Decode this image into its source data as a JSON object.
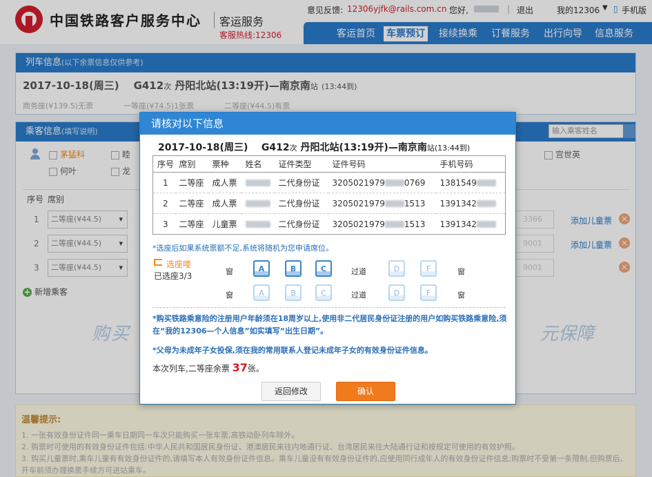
{
  "header": {
    "brand_title": "中国铁路客户服务中心",
    "brand_sub": "客运服务",
    "hotline": "客服热线:12306",
    "feedback_label": "意见反馈:",
    "feedback_email": "12306yjfk@rails.com.cn",
    "hello": "您好,",
    "logout": "退出",
    "my12306": "我的12306",
    "mobile": "手机版",
    "nav": [
      "客运首页",
      "车票预订",
      "接续换乘",
      "订餐服务",
      "出行向导",
      "信息服务"
    ],
    "nav_active": "车票预订"
  },
  "train_panel": {
    "title": "列车信息",
    "subtitle": "(以下余票信息仅供参考)",
    "date": "2017-10-18(周三)",
    "train_no": "G412",
    "ci": "次",
    "from": "丹阳北",
    "from_suffix": "站(13:19开)—",
    "to": "南京南",
    "to_suffix": "站",
    "arrive": "(13:44到)",
    "seats": "商务座(¥139.5)无票　　　　一等座(¥74.5)1张票　　　　二等座(¥44.5)有票"
  },
  "passenger_panel": {
    "title": "乘客信息",
    "subtitle": "(填写说明)",
    "search_placeholder": "输入乘客姓名",
    "passengers_visible": [
      "茅猛科",
      "何叶",
      "宫世英"
    ],
    "partial_1": "睦",
    "partial_2": "龙",
    "col_no": "序号",
    "col_seat": "席别",
    "rows": [
      {
        "no": "1",
        "seat": "二等座(¥44.5)",
        "ghost": "3366",
        "add_child": "添加儿童票"
      },
      {
        "no": "2",
        "seat": "二等座(¥44.5)",
        "ghost": "9001",
        "add_child": "添加儿童票"
      },
      {
        "no": "3",
        "seat": "二等座(¥44.5)",
        "ghost": "9001",
        "add_child": ""
      }
    ],
    "add_passenger": "新增乘客",
    "watermark_left": "购买",
    "watermark_right": "元保障"
  },
  "tips": {
    "title": "温馨提示:",
    "items": [
      "1. 一张有效身份证件同一乘车日期同一车次只能购买一张车票,高铁动卧列车除外。",
      "2. 购票时可使用的有效身份证件包括:中华人民共和国居民身份证、港澳居民来往内地通行证、台湾居民来往大陆通行证和按规定可使用的有效护照。",
      "3. 购买儿童票时,乘车儿童有有效身份证件的,请填写本人有效身份证件信息。乘车儿童没有有效身份证件的,应使用同行成年人的有效身份证件信息;购票时不受第一条限制,但购票后、开车前须办理换票手续方可进站乘车。"
    ]
  },
  "modal": {
    "title": "请核对以下信息",
    "date": "2017-10-18(周三)",
    "train_no": "G412",
    "ci": "次",
    "from": "丹阳北",
    "from_suffix": "站(13:19开)—",
    "to": "南京南",
    "to_suffix": "站",
    "arrive": "(13:44到)",
    "columns": [
      "序号",
      "席别",
      "票种",
      "姓名",
      "证件类型",
      "证件号码",
      "手机号码"
    ],
    "rows": [
      {
        "no": "1",
        "seat": "二等座",
        "type": "成人票",
        "id_type": "二代身份证",
        "id_prefix": "3205021979",
        "id_suffix": "0769",
        "phone_prefix": "1381549"
      },
      {
        "no": "2",
        "seat": "二等座",
        "type": "成人票",
        "id_type": "二代身份证",
        "id_prefix": "3205021979",
        "id_suffix": "1513",
        "phone_prefix": "1391342"
      },
      {
        "no": "3",
        "seat": "二等座",
        "type": "儿童票",
        "id_type": "二代身份证",
        "id_prefix": "3205021979",
        "id_suffix": "1513",
        "phone_prefix": "1391342"
      }
    ],
    "note": "*选座后如果系统票额不足,系统将随机为您申请席位。",
    "seat_choose_label": "选座喽",
    "seat_chosen": "已选座3/3",
    "window": "窗",
    "aisle": "过道",
    "seat_letters": [
      "A",
      "B",
      "C",
      "D",
      "F"
    ],
    "rule1": "*购买铁路乘意险的注册用户年龄须在18周岁以上,使用非二代居民身份证注册的用户如购买铁路乘意险,须在“我的12306—个人信息”如实填写“出生日期”。",
    "rule2": "*父母为未成年子女投保,须在我的常用联系人登记未成年子女的有效身份证件信息。",
    "remain_prefix": "本次列车,二等座余票",
    "remain_num": "37",
    "remain_suffix": "张。",
    "back_button": "返回修改",
    "confirm_button": "确认"
  },
  "colors": {
    "brand_red": "#d21f2b",
    "nav_blue": "#2a7ccb",
    "confirm_orange": "#f07a1e"
  }
}
